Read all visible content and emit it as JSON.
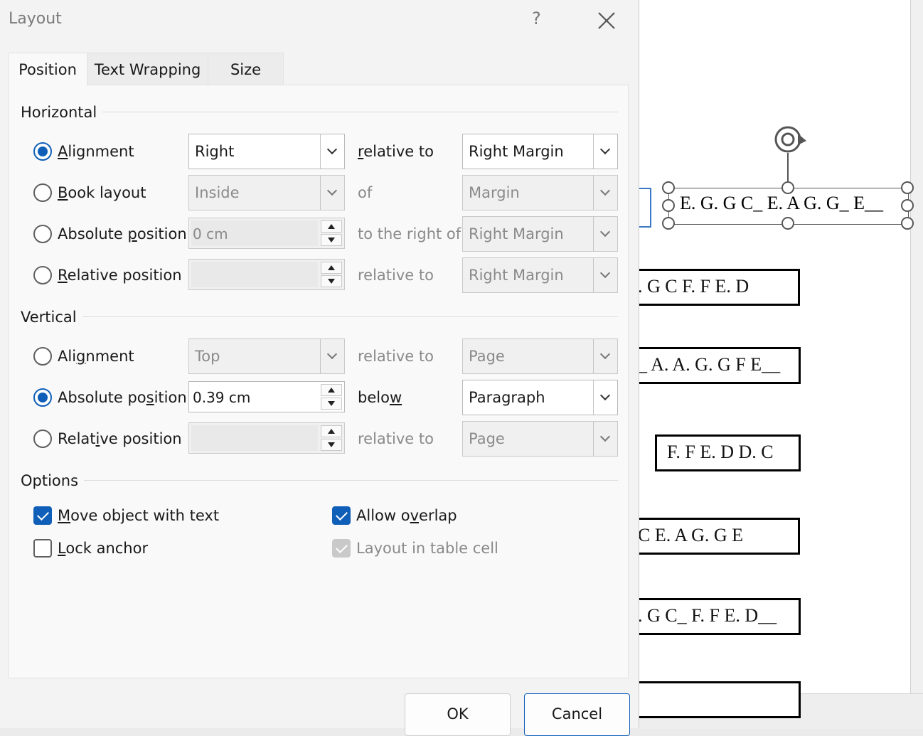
{
  "dialog": {
    "title": "Layout",
    "help": "?"
  },
  "tabs": [
    {
      "label": "Position"
    },
    {
      "label": "Text Wrapping"
    },
    {
      "label": "Size"
    }
  ],
  "horizontal": {
    "heading": "Horizontal",
    "alignment": {
      "label_u": "A",
      "label_rest": "lignment",
      "value": "Right",
      "rel_label_u": "r",
      "rel_label_rest": "elative to",
      "rel_value": "Right Margin"
    },
    "book_layout": {
      "label_u": "B",
      "label_rest": "ook layout",
      "value": "Inside",
      "rel_label": "of",
      "rel_value": "Margin"
    },
    "absolute_position": {
      "label_pre": "Absolute ",
      "label_u": "p",
      "label_rest": "osition",
      "value": "0 cm",
      "rel_label": "to the right of",
      "rel_value": "Right Margin"
    },
    "relative_position": {
      "label_u": "R",
      "label_rest": "elative position",
      "value": "",
      "rel_label": "relative to",
      "rel_value": "Right Margin"
    }
  },
  "vertical": {
    "heading": "Vertical",
    "alignment": {
      "label_pre": "Ali",
      "label_u": "g",
      "label_rest": "nment",
      "value": "Top",
      "rel_label": "relative to",
      "rel_value": "Page"
    },
    "absolute_position": {
      "label_pre": "Absolute po",
      "label_u": "s",
      "label_rest": "ition",
      "value": "0.39 cm",
      "rel_label_pre": "belo",
      "rel_label_u": "w",
      "rel_value": "Paragraph"
    },
    "relative_position": {
      "label_pre": "Relat",
      "label_u": "i",
      "label_rest": "ve position",
      "value": "",
      "rel_label": "relative to",
      "rel_value": "Page"
    }
  },
  "options": {
    "heading": "Options",
    "move_object": {
      "label_u": "M",
      "label_rest": "ove object with text",
      "checked": true
    },
    "lock_anchor": {
      "label_u": "L",
      "label_rest": "ock anchor",
      "checked": false
    },
    "allow_overlap": {
      "label_pre": "Allow o",
      "label_u": "v",
      "label_rest": "erlap",
      "checked": true
    },
    "layout_in_cell": {
      "label": "Layout in table cell",
      "checked": true,
      "disabled": true
    }
  },
  "buttons": {
    "ok": "OK",
    "cancel": "Cancel"
  },
  "document": {
    "selected_box": "E. G. G C_  E. A G. G_ E__",
    "boxes": [
      ". G C    F. F E. D",
      "_ A. A. G. G F E__",
      "F. F E. D D. C",
      "C    E. A G. G    E",
      ". G C_  F. F E. D__"
    ]
  },
  "colors": {
    "accent": "#0f5fb8"
  }
}
